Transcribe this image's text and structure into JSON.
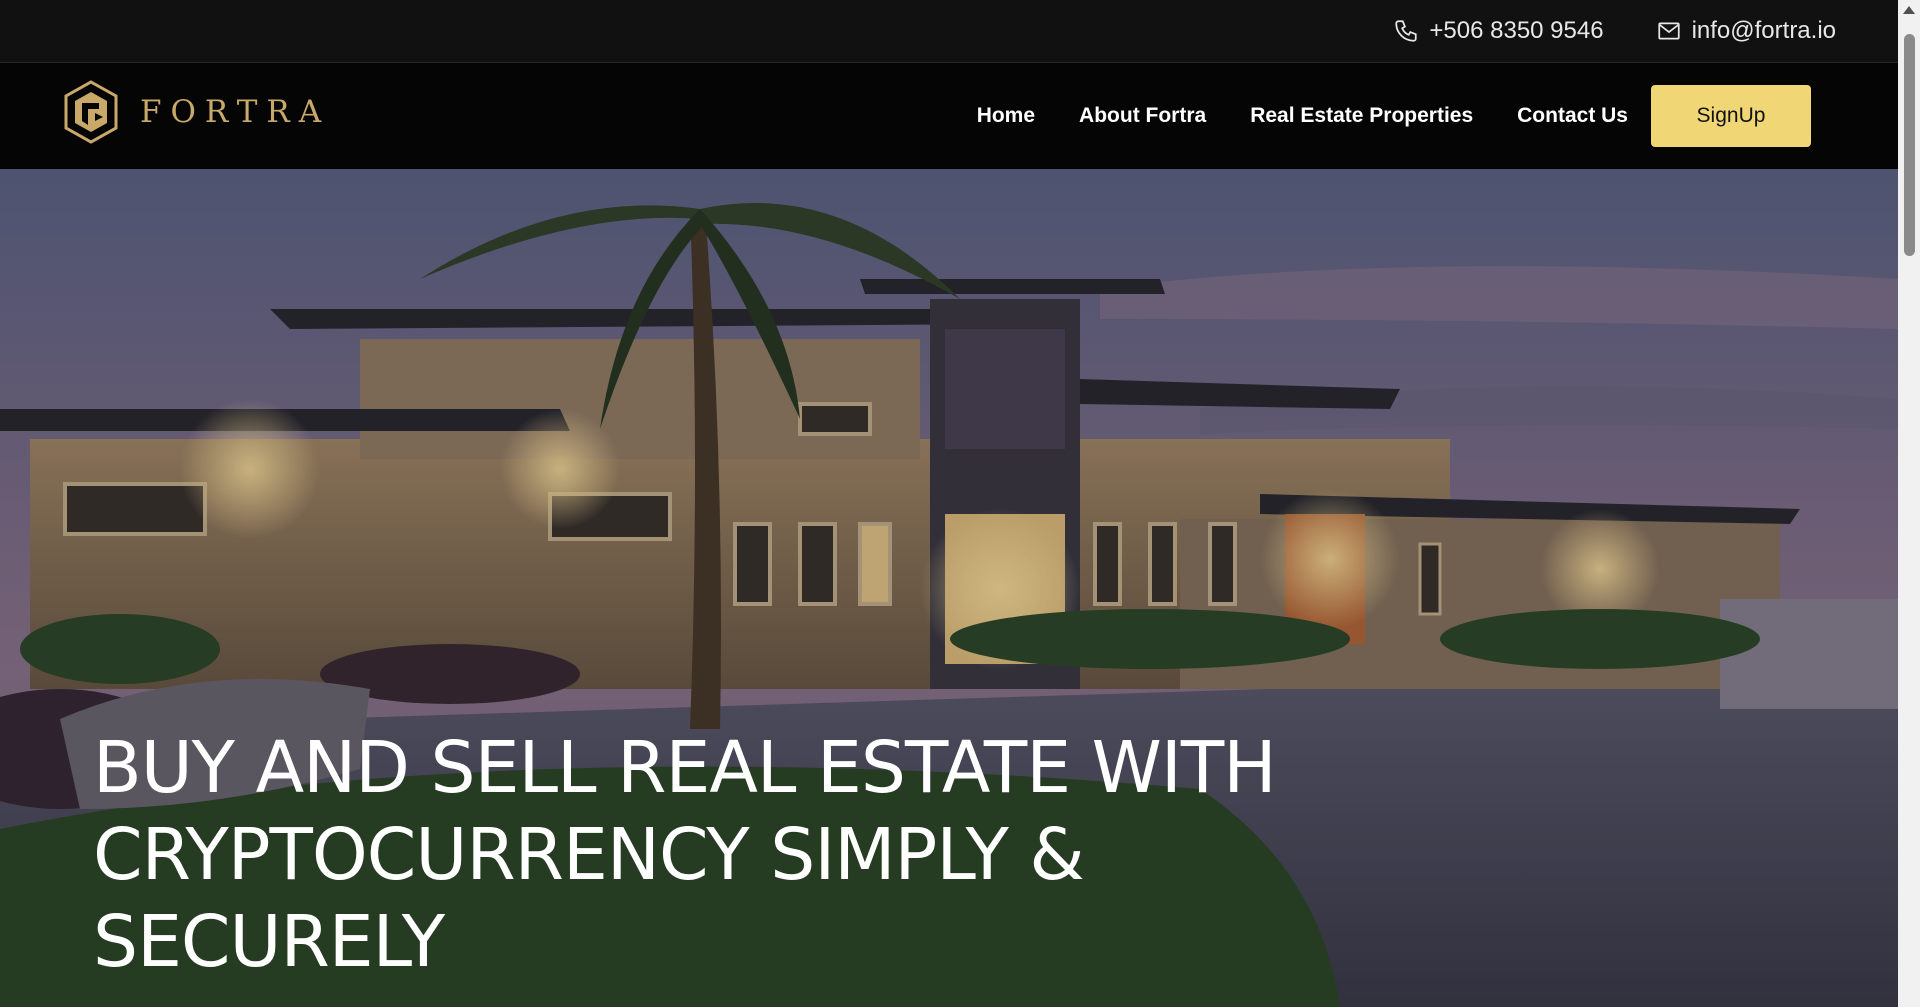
{
  "topbar": {
    "phone": "+506 8350 9546",
    "email": "info@fortra.io",
    "phone_icon": "phone-icon",
    "email_icon": "envelope-icon"
  },
  "brand": {
    "name": "FORTRA",
    "logo_icon": "fortra-hexagon-logo"
  },
  "nav": {
    "items": [
      {
        "label": "Home"
      },
      {
        "label": "About Fortra"
      },
      {
        "label": "Real Estate Properties"
      },
      {
        "label": "Contact Us"
      }
    ],
    "signup_label": "SignUp"
  },
  "hero": {
    "title": "BUY AND SELL REAL ESTATE WITH CRYPTOCURRENCY SIMPLY & SECURELY"
  },
  "colors": {
    "topbar_bg": "#111111",
    "nav_bg": "#050505",
    "brand_gold": "#c9a96a",
    "signup_bg": "#f1d675"
  }
}
